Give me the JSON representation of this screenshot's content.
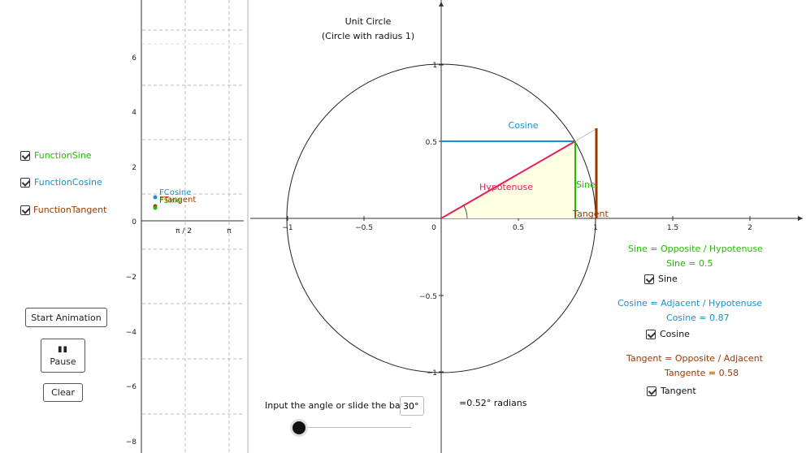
{
  "colors": {
    "sine": "#1fbf00",
    "cosine": "#1593c8",
    "tangent": "#9a3a00",
    "hypotenuse": "#e0205a",
    "axis": "#333333"
  },
  "sidebar": {
    "checkboxes": [
      {
        "label": "FunctionSine",
        "color": "#1fbf00",
        "checked": true
      },
      {
        "label": "FunctionCosine",
        "color": "#1593c8",
        "checked": true
      },
      {
        "label": "FunctionTangent",
        "color": "#9a3a00",
        "checked": true
      }
    ],
    "start_animation": "Start Animation",
    "pause": "Pause",
    "clear": "Clear"
  },
  "graph_small": {
    "y_ticks": [
      "6",
      "4",
      "2",
      "0",
      "−2",
      "−4",
      "−6",
      "−8"
    ],
    "x_ticks": [
      "π / 2",
      "π"
    ],
    "points": {
      "cosine": "FCosine",
      "tangent": "FTangent",
      "sine": "FSine"
    }
  },
  "main": {
    "title": "Unit Circle",
    "subtitle": "(Circle with radius 1)",
    "x_ticks": [
      "−1",
      "−0.5",
      "0",
      "0.5",
      "1",
      "1.5",
      "2"
    ],
    "y_ticks": [
      "1",
      "0.5",
      "−0.5",
      "−1"
    ],
    "labels": {
      "cosine": "Cosine",
      "sine": "Sine",
      "tangent": "Tangent",
      "hypotenuse": "Hypotenuse"
    },
    "angle_deg": 30
  },
  "info": {
    "sine_formula": "Sine = Opposite / Hypotenuse",
    "sine_value": "Sine = 0.5",
    "sine_checkbox": "Sine",
    "cosine_formula": "Cosine = Adjacent / Hypotenuse",
    "cosine_value": "Cosine = 0.87",
    "cosine_checkbox": "Cosine",
    "tangent_formula": "Tangent = Opposite / Adjacent",
    "tangent_value": "Tangente = 0.58",
    "tangent_checkbox": "Tangent"
  },
  "controls": {
    "input_label": "Input the angle or slide the bar:",
    "input_value": "30°",
    "radians": "=0.52° radians",
    "slider_level": 0
  }
}
